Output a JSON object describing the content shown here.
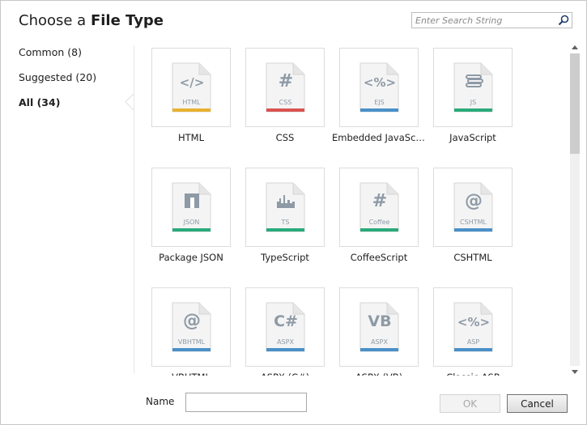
{
  "dialog": {
    "title_prefix": "Choose a ",
    "title_bold": "File Type"
  },
  "search": {
    "placeholder": "Enter Search String",
    "icon": "search-icon"
  },
  "nav": {
    "items": [
      {
        "label": "Common (8)",
        "active": false
      },
      {
        "label": "Suggested (20)",
        "active": false
      },
      {
        "label": "All (34)",
        "active": true
      }
    ]
  },
  "file_types": [
    {
      "label": "HTML",
      "badge": "HTML",
      "glyph": "</>",
      "color": "#e8b12f"
    },
    {
      "label": "CSS",
      "badge": "CSS",
      "glyph": "#",
      "color": "#d9534f"
    },
    {
      "label": "Embedded JavaScript",
      "badge": "EJS",
      "glyph": "<%>",
      "color": "#4a90c8"
    },
    {
      "label": "JavaScript",
      "badge": "JS",
      "glyph": "stack",
      "color": "#2aaa7a"
    },
    {
      "label": "Package JSON",
      "badge": "JSON",
      "glyph": "npm",
      "color": "#2aaa7a"
    },
    {
      "label": "TypeScript",
      "badge": "TS",
      "glyph": "city",
      "color": "#2aaa7a"
    },
    {
      "label": "CoffeeScript",
      "badge": "Coffee",
      "glyph": "#",
      "color": "#2aaa7a"
    },
    {
      "label": "CSHTML",
      "badge": "CSHTML",
      "glyph": "@",
      "color": "#4a90c8"
    },
    {
      "label": "VBHTML",
      "badge": "VBHTML",
      "glyph": "@",
      "color": "#4a90c8"
    },
    {
      "label": "ASPX (C#)",
      "badge": "ASPX",
      "glyph": "C#",
      "color": "#4a90c8"
    },
    {
      "label": "ASPX (VB)",
      "badge": "ASPX",
      "glyph": "VB",
      "color": "#4a90c8"
    },
    {
      "label": "Classic ASP",
      "badge": "ASP",
      "glyph": "<%>",
      "color": "#4a90c8"
    }
  ],
  "footer": {
    "name_label": "Name",
    "name_value": "",
    "ok_label": "OK",
    "ok_enabled": false,
    "cancel_label": "Cancel"
  }
}
